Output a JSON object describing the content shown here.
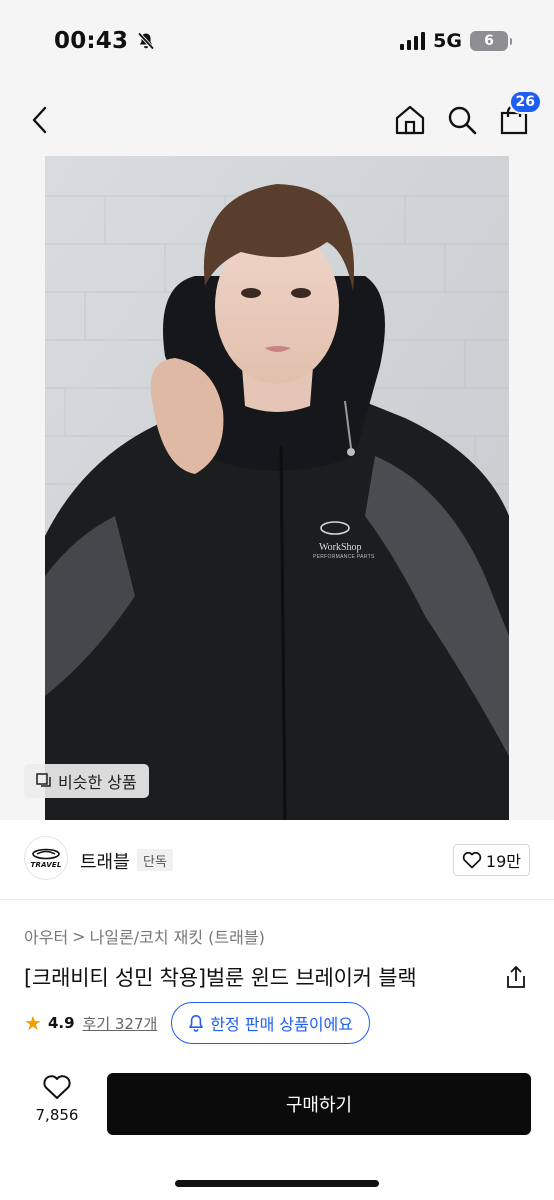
{
  "status_bar": {
    "time": "00:43",
    "network": "5G",
    "battery": "6",
    "icons": [
      "bell-slash-icon",
      "signal-icon",
      "battery-icon"
    ]
  },
  "nav": {
    "cart_count": "26",
    "icons": [
      "back-icon",
      "home-icon",
      "search-icon",
      "cart-icon"
    ]
  },
  "hero": {
    "similar_label": "비슷한 상품",
    "jacket_logo_text": "WorkShop",
    "jacket_logo_subtext": "PERFORMANCE PARTS"
  },
  "brand": {
    "logo_text": "TRAVEL",
    "name": "트래블",
    "badge": "단독",
    "like_count": "19만"
  },
  "product": {
    "breadcrumb": [
      "아우터",
      "나일론/코치 재킷 (트래블)"
    ],
    "breadcrumb_sep": ">",
    "title": "[크래비티 성민 착용]벌룬 윈드 브레이커 블랙",
    "rating": "4.9",
    "review_label": "후기 327개",
    "limited_label": "한정 판매 상품이에요"
  },
  "actions": {
    "wish_count": "7,856",
    "buy_label": "구매하기"
  },
  "colors": {
    "accent": "#1e5ef5",
    "star": "#f2a200",
    "buy_button": "#0b0b0b"
  }
}
